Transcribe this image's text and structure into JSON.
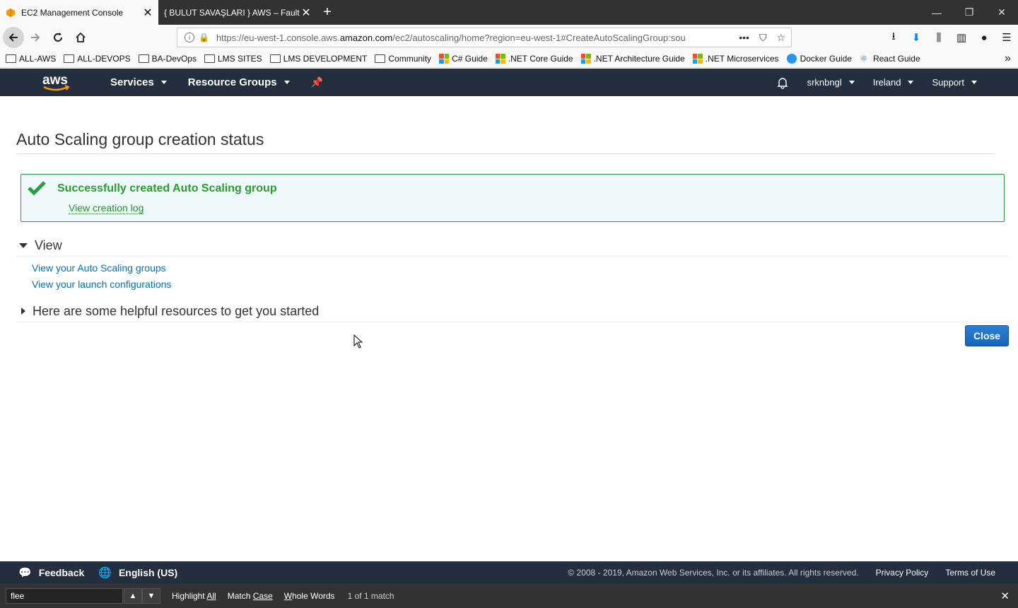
{
  "browser": {
    "tabs": [
      {
        "title": "EC2 Management Console",
        "active": true
      },
      {
        "title": "{ BULUT SAVAŞLARI } AWS – Fault To",
        "active": false
      }
    ],
    "url_prefix": "https://eu-west-1.console.aws.",
    "url_domain": "amazon.com",
    "url_suffix": "/ec2/autoscaling/home?region=eu-west-1#CreateAutoScalingGroup:sou",
    "bookmarks": [
      {
        "label": "ALL-AWS",
        "icon": "folder-icon"
      },
      {
        "label": "ALL-DEVOPS",
        "icon": "folder-icon"
      },
      {
        "label": "BA-DevOps",
        "icon": "folder-icon"
      },
      {
        "label": "LMS SITES",
        "icon": "folder-icon"
      },
      {
        "label": "LMS DEVELOPMENT",
        "icon": "folder-icon"
      },
      {
        "label": "Community",
        "icon": "folder-icon"
      },
      {
        "label": "C# Guide",
        "icon": "microsoft-icon"
      },
      {
        "label": ".NET Core Guide",
        "icon": "microsoft-icon"
      },
      {
        "label": ".NET Architecture Guide",
        "icon": "microsoft-icon"
      },
      {
        "label": ".NET Microservices",
        "icon": "microsoft-icon"
      },
      {
        "label": "Docker Guide",
        "icon": "docker-icon"
      },
      {
        "label": "React Guide",
        "icon": "react-icon"
      }
    ]
  },
  "aws_header": {
    "logo": "aws",
    "services": "Services",
    "resource_groups": "Resource Groups",
    "user": "srknbngl",
    "region": "Ireland",
    "support": "Support"
  },
  "page": {
    "title": "Auto Scaling group creation status",
    "success_message": "Successfully created Auto Scaling group",
    "view_log": "View creation log",
    "view_section": {
      "title": "View",
      "links": [
        "View your Auto Scaling groups",
        "View your launch configurations"
      ]
    },
    "resources_section": {
      "title": "Here are some helpful resources to get you started"
    },
    "close_button": "Close"
  },
  "footer": {
    "feedback": "Feedback",
    "language": "English (US)",
    "copyright": "© 2008 - 2019, Amazon Web Services, Inc. or its affiliates. All rights reserved.",
    "privacy": "Privacy Policy",
    "terms": "Terms of Use"
  },
  "findbar": {
    "query": "flee",
    "highlight_all_prefix": "Highlight ",
    "highlight_all_key": "All",
    "match_case_prefix": "Match ",
    "match_case_key": "Case",
    "whole_words_key": "W",
    "whole_words_rest": "hole Words",
    "count": "1 of 1 match"
  },
  "colors": {
    "aws_header": "#232f3e",
    "success_green": "#2a9d2c",
    "link_blue": "#0073bb",
    "primary_button": "#1a6dc2"
  }
}
